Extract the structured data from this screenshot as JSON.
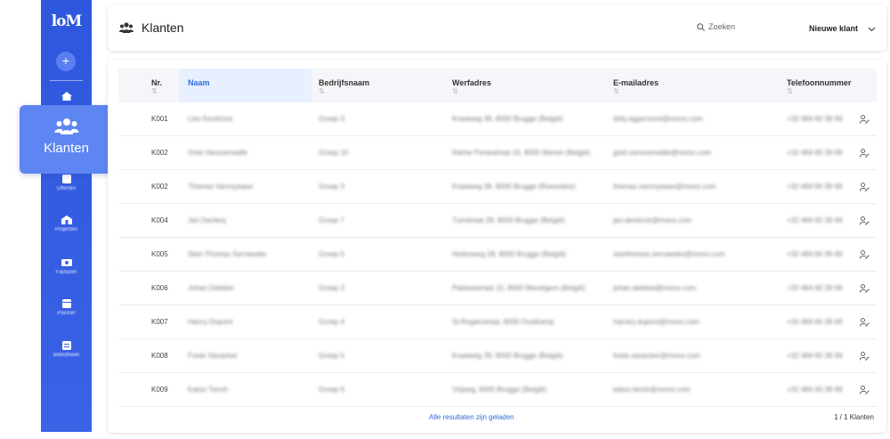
{
  "app": {
    "logo_text": "loM"
  },
  "sidebar": {
    "add_label": "+",
    "items": [
      {
        "label": "",
        "icon": "home-icon"
      },
      {
        "label": "Klanten",
        "icon": "users-icon"
      },
      {
        "label": "Offertes",
        "icon": "document-icon"
      },
      {
        "label": "Projecten",
        "icon": "building-icon"
      },
      {
        "label": "Facturen",
        "icon": "invoice-icon"
      },
      {
        "label": "Planner",
        "icon": "calendar-icon"
      },
      {
        "label": "Bibliotheek",
        "icon": "library-icon"
      }
    ],
    "active_label": "Klanten"
  },
  "header": {
    "title": "Klanten",
    "search_placeholder": "Zoeken",
    "new_client_label": "Nieuwe klant"
  },
  "table": {
    "columns": [
      "Nr.",
      "Naam",
      "Bedrijfsnaam",
      "Werfadres",
      "E-mailadres",
      "Telefoonnummer"
    ],
    "rows": [
      {
        "nr": "K001",
        "naam": "Lies Eeckhout",
        "bedrijf": "Groep 3",
        "adres": "Kraaiweg 39, 8000 Brugge (België)",
        "email": "dirkj.eggermont@mono.com",
        "tel": "+32 484 60 39 69"
      },
      {
        "nr": "K002",
        "naam": "Griet Vanoverwalle",
        "bedrijf": "Groep 10",
        "adres": "Kleine Pontestraat 16, 8000 Menen (België)",
        "email": "griet.vanoverwalle@mono.com",
        "tel": "+32 484 60 39 69"
      },
      {
        "nr": "K002",
        "naam": "Thomas Vanroyease",
        "bedrijf": "Groep 3",
        "adres": "Kraaiweg 39, 8000 Brugge (Roeselare)",
        "email": "thomas.vanroyease@mono.com",
        "tel": "+32 484 60 39 69"
      },
      {
        "nr": "K004",
        "naam": "Jan Declerq",
        "bedrijf": "Groep 7",
        "adres": "Tuinstraat 28, 8000 Brugge (België)",
        "email": "jan.declerck@mono.com",
        "tel": "+32 484 60 39 69"
      },
      {
        "nr": "K005",
        "naam": "Stan-Thomas Servaeske",
        "bedrijf": "Groep 5",
        "adres": "Heilesweg 28, 8000 Brugge (België)",
        "email": "stanthomas.servaeske@mono.com",
        "tel": "+32 484 60 39 69"
      },
      {
        "nr": "K006",
        "naam": "Johan Delebel",
        "bedrijf": "Groep 3",
        "adres": "Paletsestraat 15, 8000 Wevelgem (België)",
        "email": "johan.delebel@mono.com",
        "tel": "+32 484 60 39 69"
      },
      {
        "nr": "K007",
        "naam": "Harrry Dupont",
        "bedrijf": "Groep 4",
        "adres": "St.Rogierstraat, 8000 Oostkamp",
        "email": "harrary.dupont@mono.com",
        "tel": "+32 484 60 39 69"
      },
      {
        "nr": "K008",
        "naam": "Freds Vanacker",
        "bedrijf": "Groep 5",
        "adres": "Kraaiweg 39, 8000 Brugge (België)",
        "email": "freds.vanacker@mono.com",
        "tel": "+32 484 60 39 69"
      },
      {
        "nr": "K009",
        "naam": "Katoo Tiersh",
        "bedrijf": "Groep 6",
        "adres": "Vrijweg, 8000 Brugge (België)",
        "email": "katoo.tiersh@mono.com",
        "tel": "+32 484 60 39 69"
      }
    ]
  },
  "footer": {
    "loaded_text": "Alle resultaten zijn geladen",
    "count_text": "1 / 1 Klanten"
  },
  "colors": {
    "sidebar": "#2f57dd",
    "active_pill": "#5d86f2",
    "accent": "#2f6be0"
  }
}
